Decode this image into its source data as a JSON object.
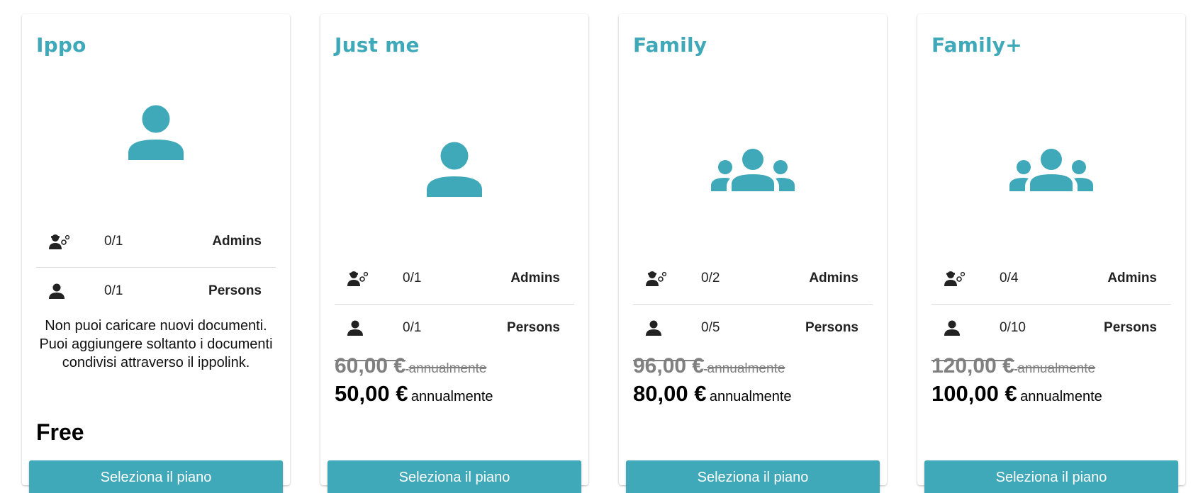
{
  "colors": {
    "accent": "#3fa8b9",
    "strike": "#808080"
  },
  "plans": [
    {
      "title": "Ippo",
      "hero_icon": "person-icon",
      "admins": {
        "value": "0/1",
        "label": "Admins",
        "icon": "admin-gear-icon"
      },
      "persons": {
        "value": "0/1",
        "label": "Persons",
        "icon": "person-small-icon"
      },
      "note": "Non puoi caricare nuovi documenti. Puoi aggiungere soltanto i documenti condivisi attraverso il ippolink.",
      "price_label": "Free",
      "button_label": "Seleziona il piano"
    },
    {
      "title": "Just me",
      "hero_icon": "person-icon",
      "admins": {
        "value": "0/1",
        "label": "Admins",
        "icon": "admin-gear-icon"
      },
      "persons": {
        "value": "0/1",
        "label": "Persons",
        "icon": "person-small-icon"
      },
      "old_price": "60,00 €",
      "old_period": "annualmente",
      "new_price": "50,00 €",
      "new_period": "annualmente",
      "button_label": "Seleziona il piano"
    },
    {
      "title": "Family",
      "hero_icon": "group-icon",
      "admins": {
        "value": "0/2",
        "label": "Admins",
        "icon": "admin-gear-icon"
      },
      "persons": {
        "value": "0/5",
        "label": "Persons",
        "icon": "person-small-icon"
      },
      "old_price": "96,00 €",
      "old_period": "annualmente",
      "new_price": "80,00 €",
      "new_period": "annualmente",
      "button_label": "Seleziona il piano"
    },
    {
      "title": "Family+",
      "hero_icon": "group-icon",
      "admins": {
        "value": "0/4",
        "label": "Admins",
        "icon": "admin-gear-icon"
      },
      "persons": {
        "value": "0/10",
        "label": "Persons",
        "icon": "person-small-icon"
      },
      "old_price": "120,00 €",
      "old_period": "annualmente",
      "new_price": "100,00 €",
      "new_period": "annualmente",
      "button_label": "Seleziona il piano"
    }
  ]
}
